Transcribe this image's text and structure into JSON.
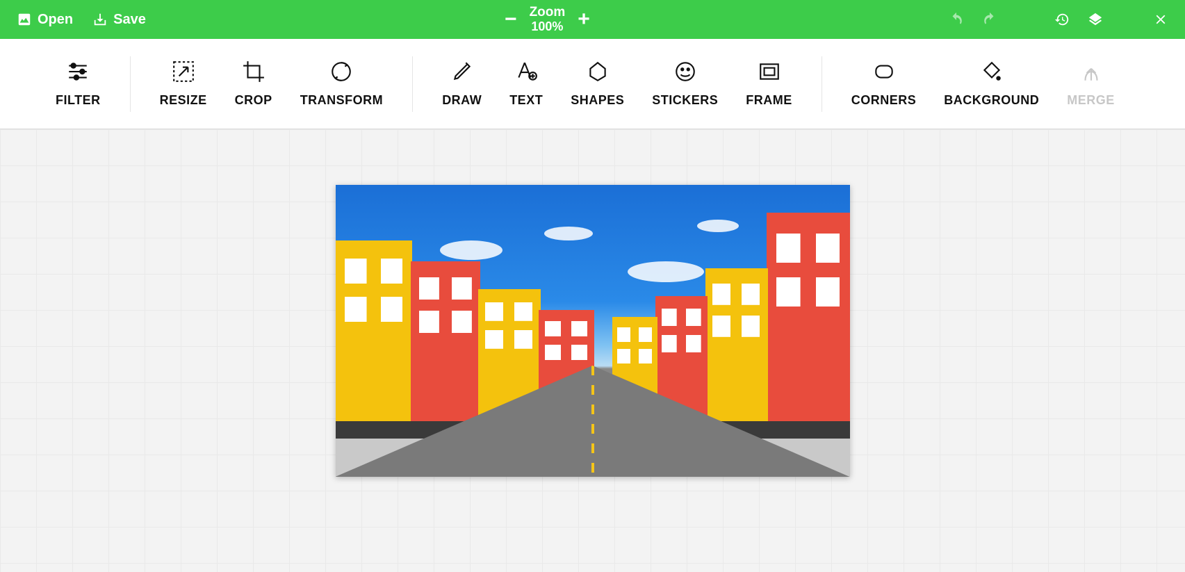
{
  "topbar": {
    "open": "Open",
    "save": "Save",
    "zoom_label": "Zoom",
    "zoom_value": "100%"
  },
  "tools": {
    "filter": "FILTER",
    "resize": "RESIZE",
    "crop": "CROP",
    "transform": "TRANSFORM",
    "draw": "DRAW",
    "text": "TEXT",
    "shapes": "SHAPES",
    "stickers": "STICKERS",
    "frame": "FRAME",
    "corners": "CORNERS",
    "background": "BACKGROUND",
    "merge": "MERGE"
  }
}
